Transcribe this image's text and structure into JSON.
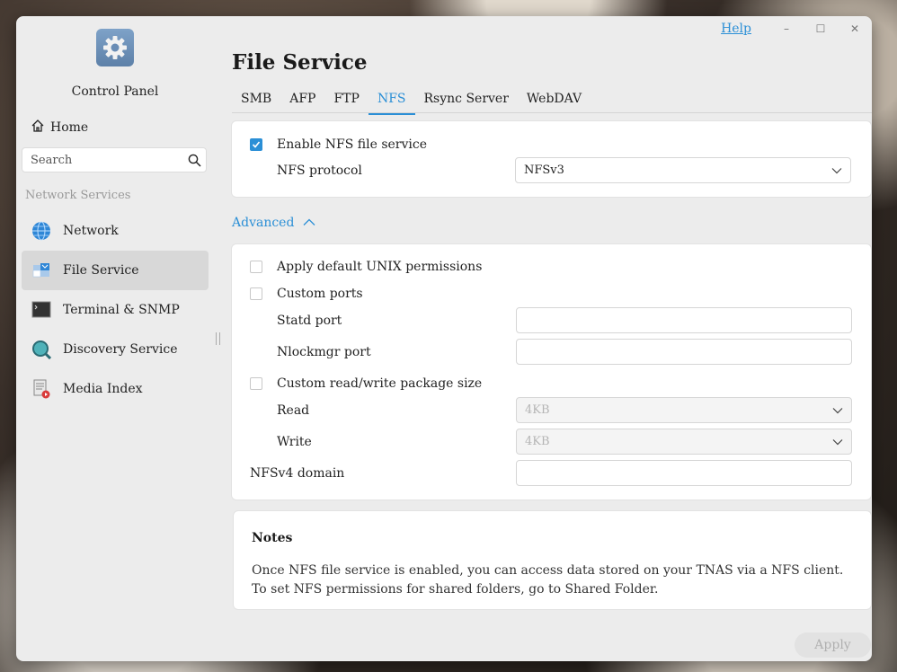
{
  "window": {
    "help_label": "Help",
    "minimize": "–",
    "maximize": "☐",
    "close": "✕"
  },
  "sidebar": {
    "app_name": "Control Panel",
    "home_label": "Home",
    "search_placeholder": "Search",
    "section_label": "Network Services",
    "items": [
      {
        "label": "Network",
        "icon": "globe-icon"
      },
      {
        "label": "File Service",
        "icon": "file-service-icon",
        "active": true
      },
      {
        "label": "Terminal & SNMP",
        "icon": "terminal-icon"
      },
      {
        "label": "Discovery Service",
        "icon": "magnifier-icon"
      },
      {
        "label": "Media Index",
        "icon": "media-index-icon"
      }
    ]
  },
  "main": {
    "title": "File Service",
    "tabs": [
      "SMB",
      "AFP",
      "FTP",
      "NFS",
      "Rsync Server",
      "WebDAV"
    ],
    "active_tab": "NFS",
    "enable_label": "Enable NFS file service",
    "protocol_label": "NFS protocol",
    "protocol_value": "NFSv3",
    "advanced_label": "Advanced",
    "advanced": {
      "unix_perm_label": "Apply default UNIX permissions",
      "custom_ports_label": "Custom ports",
      "statd_label": "Statd port",
      "statd_value": "",
      "nlockmgr_label": "Nlockmgr port",
      "nlockmgr_value": "",
      "package_size_label": "Custom read/write package size",
      "read_label": "Read",
      "read_value": "4KB",
      "write_label": "Write",
      "write_value": "4KB",
      "nfsv4_label": "NFSv4 domain",
      "nfsv4_value": ""
    },
    "notes_title": "Notes",
    "notes_body": "Once NFS file service is enabled, you can access data stored on your TNAS via a NFS client. To set NFS permissions for shared folders, go to Shared Folder.",
    "apply_label": "Apply"
  },
  "colors": {
    "accent": "#2b8fd6"
  }
}
